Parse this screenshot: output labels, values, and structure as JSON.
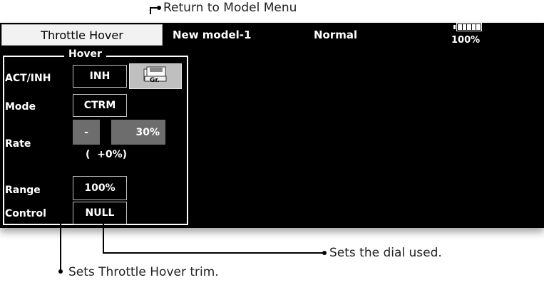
{
  "annotations": {
    "return_to_model_menu": "Return to Model Menu",
    "sets_dial": "Sets the dial used.",
    "sets_trim": "Sets Throttle Hover trim."
  },
  "header": {
    "title": "Throttle Hover",
    "model": "New model-1",
    "condition": "Normal",
    "battery_percent": "100%",
    "battery_level": 1.0
  },
  "hover": {
    "group_title": "Hover",
    "act_inh": {
      "label": "ACT/INH",
      "value": "INH",
      "group_button": "Gr."
    },
    "mode": {
      "label": "Mode",
      "value": "CTRM"
    },
    "rate": {
      "label": "Rate",
      "minus": "-",
      "value": "30%",
      "offset": "(  +0%)"
    },
    "range": {
      "label": "Range",
      "value": "100%"
    },
    "control": {
      "label": "Control",
      "value": "NULL"
    }
  },
  "colors": {
    "screen_bg": "#000000",
    "button_gray": "#6d6d6d",
    "title_bg": "#f2f2f2"
  }
}
